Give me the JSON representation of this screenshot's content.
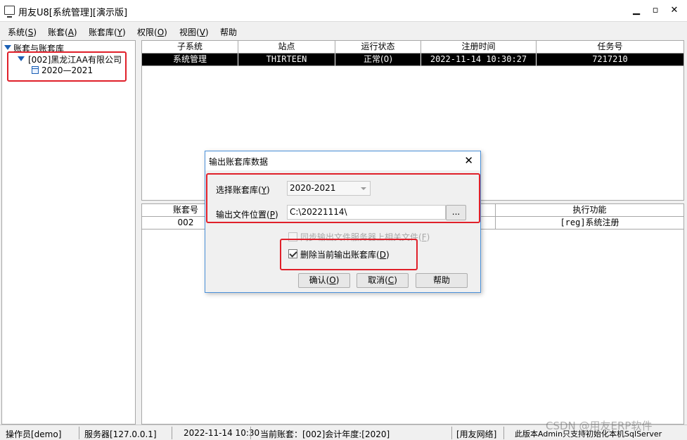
{
  "window": {
    "title": "用友U8[系统管理][演示版]",
    "minimize": "▁",
    "restore": "▫",
    "close": "✕"
  },
  "menu": [
    {
      "label": "系统(",
      "key": "S",
      "end": ")"
    },
    {
      "label": "账套(",
      "key": "A",
      "end": ")"
    },
    {
      "label": "账套库(",
      "key": "Y",
      "end": ")"
    },
    {
      "label": "权限(",
      "key": "O",
      "end": ")"
    },
    {
      "label": "视图(",
      "key": "V",
      "end": ")"
    },
    {
      "label": "帮助",
      "key": "",
      "end": ""
    }
  ],
  "tree": {
    "root": "账套与账套库",
    "account": "[002]黑龙江AA有限公司",
    "year": "2020—2021"
  },
  "top_grid": {
    "headers": [
      "子系统",
      "站点",
      "运行状态",
      "注册时间",
      "任务号"
    ],
    "rows": [
      [
        "系统管理",
        "THIRTEEN",
        "正常(0)",
        "2022-11-14 10:30:27",
        "7217210"
      ]
    ]
  },
  "bottom_grid": {
    "headers": [
      "账套号",
      "执行功能"
    ],
    "rows": [
      [
        "002",
        "[reg]系统注册"
      ]
    ]
  },
  "dialog": {
    "title": "输出账套库数据",
    "close": "✕",
    "select_label": "选择账套库(",
    "select_key": "Y",
    "select_end": ")",
    "select_value": "2020-2021",
    "path_label": "输出文件位置(",
    "path_key": "P",
    "path_end": ")",
    "path_value": "C:\\20221114\\",
    "browse": "...",
    "sync_label": "同步输出文件服务器上相关文件(",
    "sync_key": "F",
    "sync_end": ")",
    "delete_label": "删除当前输出账套库(",
    "delete_key": "D",
    "delete_end": ")",
    "ok_label": "确认(",
    "ok_key": "O",
    "ok_end": ")",
    "cancel_label": "取消(",
    "cancel_key": "C",
    "cancel_end": ")",
    "help_label": "帮助"
  },
  "status": {
    "operator": "操作员[demo]",
    "server": "服务器[127.0.0.1]",
    "time": "2022-11-14 10:30",
    "current": "当前账套：[002]会计年度:[2020]",
    "network": "[用友网络]",
    "version": "此版本Admin只支持初始化本机SqlServer"
  },
  "watermark": "CSDN @用友ERP软件",
  "colors": {
    "accent": "#1a5fb4",
    "highlight_box": "#e0202a",
    "dialog_border": "#4a90d9",
    "selected_row": "#000000"
  }
}
